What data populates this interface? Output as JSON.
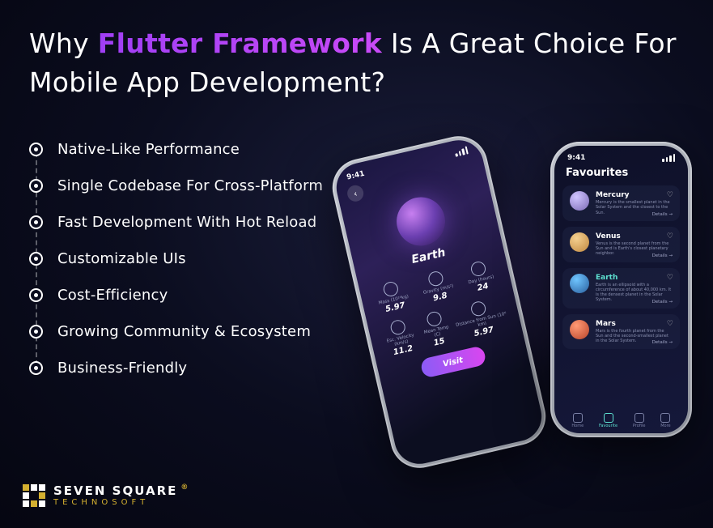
{
  "headline": {
    "pre": "Why ",
    "highlight": "Flutter Framework",
    "post": " Is A Great Choice For Mobile App Development?"
  },
  "features": [
    "Native-Like Performance",
    "Single Codebase For Cross-Platform",
    "Fast Development With Hot Reload",
    "Customizable UIs",
    "Cost-Efficiency",
    "Growing Community & Ecosystem",
    "Business-Friendly"
  ],
  "phone_left": {
    "time": "9:41",
    "planet_name": "Earth",
    "stats_row1": [
      {
        "label": "Mass\n(10²⁴kg)",
        "value": "5.97"
      },
      {
        "label": "Gravity\n(m/s²)",
        "value": "9.8"
      },
      {
        "label": "Day\n(hours)",
        "value": "24"
      }
    ],
    "stats_row2": [
      {
        "label": "Esc. Velocity\n(km/s)",
        "value": "11.2"
      },
      {
        "label": "Mean\nTemp (C)",
        "value": "15"
      },
      {
        "label": "Distance from\nSun (10⁶ km)",
        "value": "5.97"
      }
    ],
    "visit_label": "Visit"
  },
  "phone_right": {
    "time": "9:41",
    "page_title": "Favourites",
    "items": [
      {
        "name": "Mercury",
        "desc": "Mercury is the smallest planet in the Solar System and the closest to the Sun.",
        "details": "Details →"
      },
      {
        "name": "Venus",
        "desc": "Venus is the second planet from the Sun and is Earth's closest planetary neighbor.",
        "details": "Details →"
      },
      {
        "name": "Earth",
        "desc": "Earth is an ellipsoid with a circumference of about 40,000 km. It is the densest planet in the Solar System.",
        "details": "Details →"
      },
      {
        "name": "Mars",
        "desc": "Mars is the fourth planet from the Sun and the second-smallest planet in the Solar System.",
        "details": "Details →"
      }
    ],
    "nav": [
      {
        "label": "Home"
      },
      {
        "label": "Favourite"
      },
      {
        "label": "Profile"
      },
      {
        "label": "More"
      }
    ]
  },
  "logo": {
    "line1": "SEVEN SQUARE",
    "reg": "®",
    "line2": "TECHNOSOFT"
  }
}
